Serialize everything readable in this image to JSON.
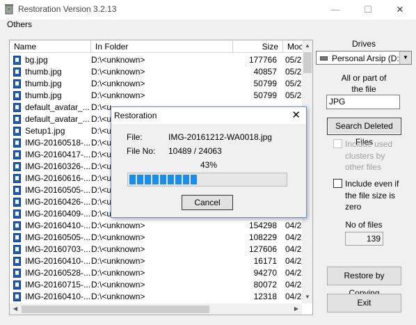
{
  "window": {
    "title": "Restoration Version 3.2.13",
    "minimize_glyph": "—",
    "maximize_glyph": "☐",
    "close_glyph": "✕"
  },
  "menu": {
    "others": "Others"
  },
  "list": {
    "columns": [
      "Name",
      "In Folder",
      "Size",
      "Moc"
    ],
    "rows": [
      {
        "name": "bg.jpg",
        "folder": "D:\\<unknown>",
        "size": "177766",
        "mod": "05/2"
      },
      {
        "name": "thumb.jpg",
        "folder": "D:\\<unknown>",
        "size": "40857",
        "mod": "05/2"
      },
      {
        "name": "thumb.jpg",
        "folder": "D:\\<unknown>",
        "size": "50799",
        "mod": "05/2"
      },
      {
        "name": "thumb.jpg",
        "folder": "D:\\<unknown>",
        "size": "50799",
        "mod": "05/2"
      },
      {
        "name": "default_avatar_...",
        "folder": "D:\\<u",
        "size": "",
        "mod": ""
      },
      {
        "name": "default_avatar_...",
        "folder": "D:\\<u",
        "size": "",
        "mod": ""
      },
      {
        "name": "Setup1.jpg",
        "folder": "D:\\<u",
        "size": "",
        "mod": ""
      },
      {
        "name": "IMG-20160518-...",
        "folder": "D:\\<u",
        "size": "",
        "mod": ""
      },
      {
        "name": "IMG-20160417-...",
        "folder": "D:\\<u",
        "size": "",
        "mod": ""
      },
      {
        "name": "IMG-20160326-...",
        "folder": "D:\\<u",
        "size": "",
        "mod": ""
      },
      {
        "name": "IMG-20160616-...",
        "folder": "D:\\<u",
        "size": "",
        "mod": ""
      },
      {
        "name": "IMG-20160505-...",
        "folder": "D:\\<u",
        "size": "",
        "mod": ""
      },
      {
        "name": "IMG-20160426-...",
        "folder": "D:\\<u",
        "size": "",
        "mod": ""
      },
      {
        "name": "IMG-20160409-...",
        "folder": "D:\\<u",
        "size": "",
        "mod": ""
      },
      {
        "name": "IMG-20160410-...",
        "folder": "D:\\<unknown>",
        "size": "154298",
        "mod": "04/2"
      },
      {
        "name": "IMG-20160505-...",
        "folder": "D:\\<unknown>",
        "size": "108229",
        "mod": "04/2"
      },
      {
        "name": "IMG-20160703-...",
        "folder": "D:\\<unknown>",
        "size": "127606",
        "mod": "04/2"
      },
      {
        "name": "IMG-20160410-...",
        "folder": "D:\\<unknown>",
        "size": "16171",
        "mod": "04/2"
      },
      {
        "name": "IMG-20160528-...",
        "folder": "D:\\<unknown>",
        "size": "94270",
        "mod": "04/2"
      },
      {
        "name": "IMG-20160715-...",
        "folder": "D:\\<unknown>",
        "size": "80072",
        "mod": "04/2"
      },
      {
        "name": "IMG-20160410-...",
        "folder": "D:\\<unknown>",
        "size": "12318",
        "mod": "04/2"
      }
    ]
  },
  "panel": {
    "drives_label": "Drives",
    "drive_selected": "Personal Arsip (D:)",
    "file_label_line1": "All or part of",
    "file_label_line2": "the file",
    "file_value": "JPG",
    "search_button": "Search Deleted Files",
    "opt_clusters_line1": "Include used",
    "opt_clusters_line2": "clusters by",
    "opt_clusters_line3": "other files",
    "opt_zero_line1": "Include even if",
    "opt_zero_line2": "the file size is",
    "opt_zero_line3": "zero",
    "no_of_files_label": "No of files",
    "no_of_files_value": "139",
    "restore_button": "Restore by Copying",
    "exit_button": "Exit"
  },
  "dialog": {
    "title": "Restoration",
    "close_glyph": "✕",
    "file_label": "File:",
    "file_value": "IMG-20161212-WA0018.jpg",
    "fileno_label": "File No:",
    "fileno_value": "10489 / 24063",
    "percent_text": "43%",
    "progress_fraction": 0.43,
    "cancel_button": "Cancel"
  },
  "colors": {
    "progress": "#1a8ce9",
    "file_icon": "#1e5fb6"
  }
}
